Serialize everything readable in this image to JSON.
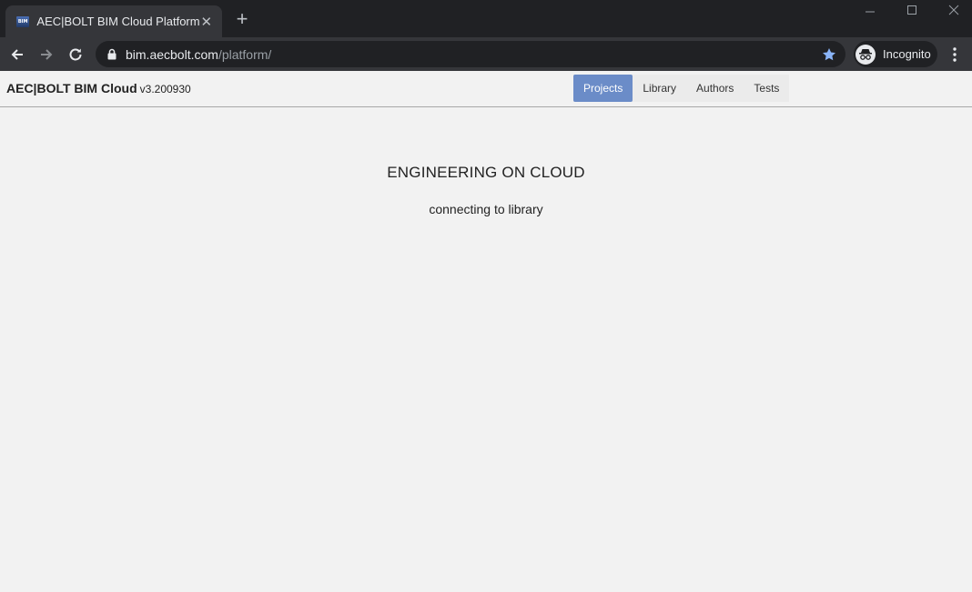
{
  "browser": {
    "tab_title": "AEC|BOLT BIM Cloud Platform",
    "favicon_text": "BIM",
    "url_host": "bim.aecbolt.com",
    "url_path": "/platform/",
    "incognito_label": "Incognito"
  },
  "app": {
    "brand_name": "AEC|BOLT BIM Cloud",
    "version": "v3.200930",
    "nav": [
      {
        "label": "Projects",
        "active": true
      },
      {
        "label": "Library",
        "active": false
      },
      {
        "label": "Authors",
        "active": false
      },
      {
        "label": "Tests",
        "active": false
      }
    ],
    "heading": "ENGINEERING ON CLOUD",
    "status": "connecting to library"
  }
}
